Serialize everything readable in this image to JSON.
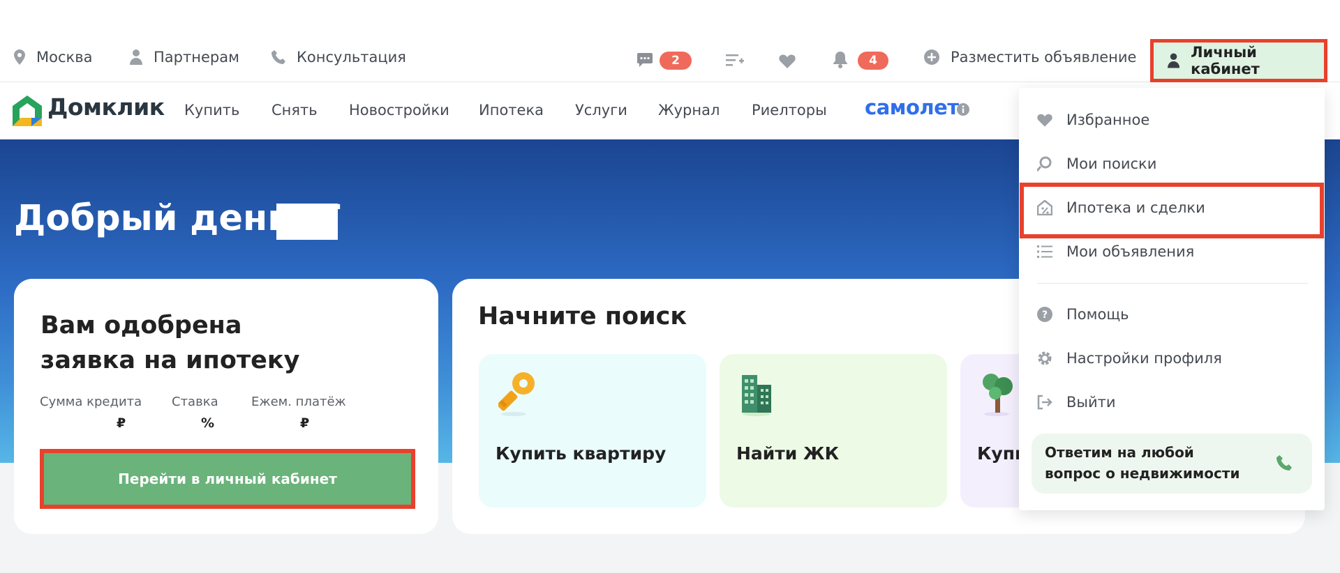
{
  "colors": {
    "accent_green": "#6ab37a",
    "badge_red": "#ef6a5a",
    "highlight_red": "#e8412c",
    "samolet_blue": "#2f6fea",
    "hero_top": "#1b4591",
    "hero_bottom": "#56b6e6"
  },
  "topbar": {
    "city": "Москва",
    "partners": "Партнерам",
    "consultation": "Консультация",
    "messages_count": "2",
    "notifications_count": "4",
    "post_ad": "Разместить объявление",
    "cabinet": "Личный кабинет",
    "icons": [
      "location-pin-icon",
      "person-icon",
      "phone-icon",
      "chat-icon",
      "compare-list-icon",
      "heart-icon",
      "bell-icon",
      "plus-circle-icon",
      "user-icon"
    ]
  },
  "nav": {
    "logo": "Домклик",
    "items": [
      "Купить",
      "Снять",
      "Новостройки",
      "Ипотека",
      "Услуги",
      "Журнал",
      "Риелторы"
    ],
    "samolet": "самолет"
  },
  "hero": {
    "greeting": "Добрый день, Т"
  },
  "approval": {
    "title": "Вам одобрена заявка на ипотеку",
    "labels": [
      "Сумма кредита",
      "Ставка",
      "Ежем. платёж"
    ],
    "units": [
      "₽",
      "%",
      "₽"
    ],
    "button": "Перейти в личный кабинет"
  },
  "search": {
    "title": "Начните поиск",
    "tiles": [
      {
        "label": "Купить квартиру",
        "icon": "key-icon",
        "bg": "#eafcfc"
      },
      {
        "label": "Найти ЖК",
        "icon": "building-icon",
        "bg": "#ecfae6"
      },
      {
        "label": "Купи",
        "icon": "tree-icon",
        "bg": "#f4effd"
      }
    ]
  },
  "dropdown": {
    "items": [
      "Избранное",
      "Мои поиски",
      "Ипотека и сделки",
      "Мои объявления",
      "Помощь",
      "Настройки профиля",
      "Выйти"
    ],
    "support_text": "Ответим на любой вопрос о недвижимости"
  }
}
